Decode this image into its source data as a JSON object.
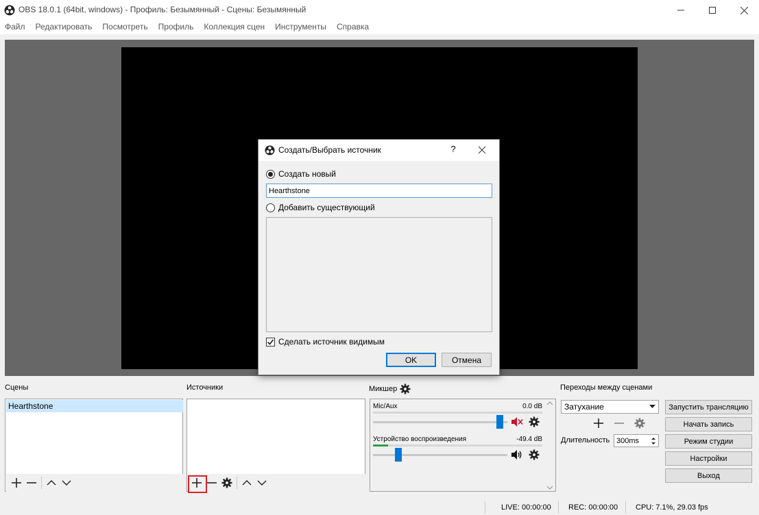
{
  "window": {
    "title": "OBS 18.0.1 (64bit, windows) - Профиль: Безымянный - Сцены: Безымянный"
  },
  "menu": [
    "Файл",
    "Редактировать",
    "Посмотреть",
    "Профиль",
    "Коллекция сцен",
    "Инструменты",
    "Справка"
  ],
  "dialog": {
    "title": "Создать/Выбрать источник",
    "help": "?",
    "create_new_label": "Создать новый",
    "name_value": "Hearthstone",
    "add_existing_label": "Добавить существующий",
    "make_visible_label": "Сделать источник видимым",
    "ok_label": "OK",
    "cancel_label": "Отмена",
    "create_new_selected": true,
    "make_visible_checked": true
  },
  "docks": {
    "scenes_label": "Сцены",
    "sources_label": "Источники",
    "mixer_label": "Микшер",
    "transitions_label": "Переходы между сценами"
  },
  "scenes": [
    "Hearthstone"
  ],
  "mixer": {
    "channels": [
      {
        "name": "Mic/Aux",
        "db": "0.0 dB",
        "muted": true,
        "volume": 0.97
      },
      {
        "name": "Устройство воспроизведения",
        "db": "-49.4 dB",
        "muted": false,
        "volume": 0.17
      }
    ]
  },
  "transitions": {
    "selected": "Затухание",
    "duration_label": "Длительность",
    "duration_value": "300ms"
  },
  "controls": {
    "start_stream": "Запустить трансляцию",
    "start_record": "Начать запись",
    "studio_mode": "Режим студии",
    "settings": "Настройки",
    "exit": "Выход"
  },
  "status": {
    "live": "LIVE: 00:00:00",
    "rec": "REC: 00:00:00",
    "cpu": "CPU: 7.1%, 29.03 fps"
  },
  "colors": {
    "accent": "#0078d7",
    "highlight": "#d9222a",
    "preview_bg": "#676767",
    "mute_red": "#c8102e"
  }
}
